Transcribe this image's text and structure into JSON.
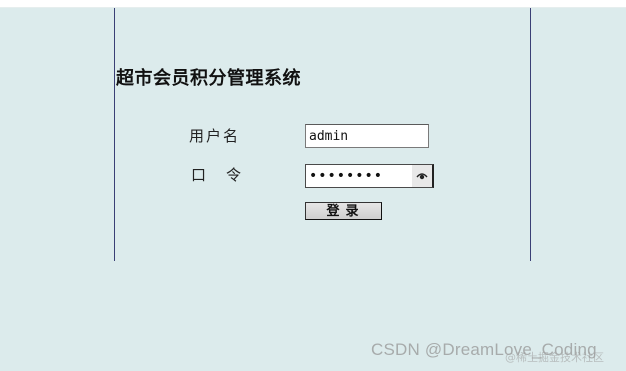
{
  "app": {
    "title": "超市会员积分管理系统"
  },
  "form": {
    "username_label": "用户名",
    "username_value": "admin",
    "password_label_char1": "口",
    "password_label_char2": "令",
    "password_masked": "••••••••",
    "login_label": "登录"
  },
  "watermark": {
    "text": "CSDN @DreamLove_Coding",
    "subtext": "@稀土掘金技术社区"
  },
  "icons": {
    "password_toggle": "eye-icon"
  },
  "colors": {
    "background": "#dcebec",
    "frame_line": "#3a3f75"
  }
}
